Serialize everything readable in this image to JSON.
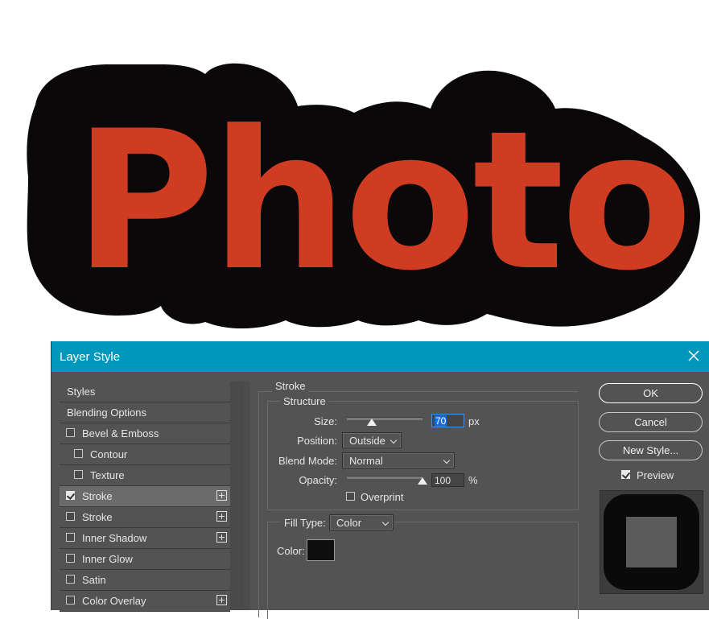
{
  "canvas": {
    "text": "Photo",
    "text_color": "#cf3c22",
    "stroke_color": "#0a0809"
  },
  "dialog": {
    "title": "Layer Style",
    "styles_list": {
      "items": [
        {
          "label": "Styles",
          "type": "header",
          "checked": false,
          "has_plus": false,
          "active": false
        },
        {
          "label": "Blending Options",
          "type": "header",
          "checked": false,
          "has_plus": false,
          "active": false
        },
        {
          "label": "Bevel & Emboss",
          "type": "option",
          "checked": false,
          "has_plus": false,
          "active": false
        },
        {
          "label": "Contour",
          "type": "sub",
          "checked": false,
          "has_plus": false,
          "active": false
        },
        {
          "label": "Texture",
          "type": "sub",
          "checked": false,
          "has_plus": false,
          "active": false
        },
        {
          "label": "Stroke",
          "type": "option",
          "checked": true,
          "has_plus": true,
          "active": true
        },
        {
          "label": "Stroke",
          "type": "option",
          "checked": false,
          "has_plus": true,
          "active": false
        },
        {
          "label": "Inner Shadow",
          "type": "option",
          "checked": false,
          "has_plus": true,
          "active": false
        },
        {
          "label": "Inner Glow",
          "type": "option",
          "checked": false,
          "has_plus": false,
          "active": false
        },
        {
          "label": "Satin",
          "type": "option",
          "checked": false,
          "has_plus": false,
          "active": false
        },
        {
          "label": "Color Overlay",
          "type": "option",
          "checked": false,
          "has_plus": true,
          "active": false
        }
      ]
    },
    "stroke": {
      "section_title": "Stroke",
      "structure_title": "Structure",
      "size_label": "Size:",
      "size_value": "70",
      "size_unit": "px",
      "size_slider_fraction": 0.33,
      "position_label": "Position:",
      "position_value": "Outside",
      "blend_mode_label": "Blend Mode:",
      "blend_mode_value": "Normal",
      "opacity_label": "Opacity:",
      "opacity_value": "100",
      "opacity_unit": "%",
      "opacity_slider_fraction": 1.0,
      "overprint_label": "Overprint",
      "overprint_checked": false,
      "fill_type_label": "Fill Type:",
      "fill_type_value": "Color",
      "color_label": "Color:",
      "color_value": "#0f0f0f"
    },
    "buttons": {
      "ok": "OK",
      "cancel": "Cancel",
      "new_style": "New Style...",
      "preview_label": "Preview",
      "preview_checked": true
    }
  }
}
